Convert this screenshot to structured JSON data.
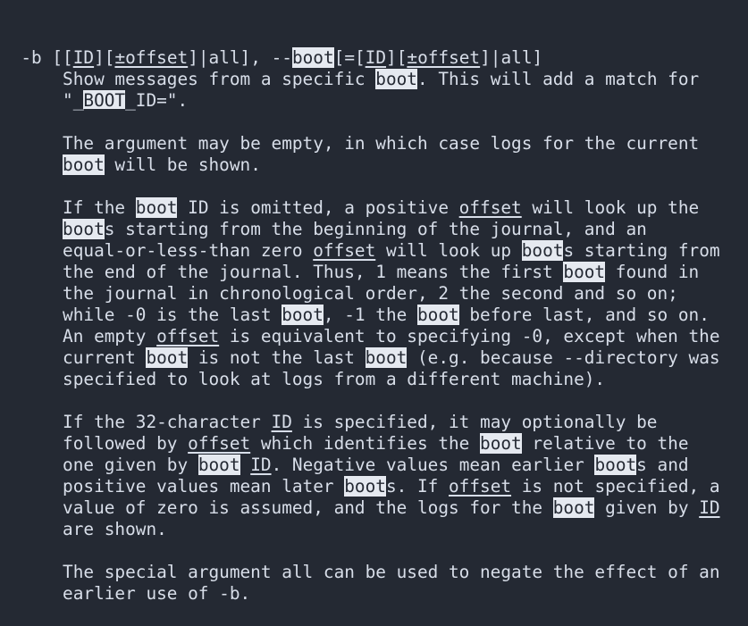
{
  "man_page": {
    "lines": [
      [
        [
          "  -b [[",
          ""
        ],
        [
          "ID",
          "ul"
        ],
        [
          "][",
          ""
        ],
        [
          "±offset",
          "ul"
        ],
        [
          "]|all], --",
          ""
        ],
        [
          "boot",
          "hl"
        ],
        [
          "[=[",
          ""
        ],
        [
          "ID",
          "ul"
        ],
        [
          "][",
          ""
        ],
        [
          "±offset",
          "ul"
        ],
        [
          "]|all]",
          ""
        ]
      ],
      [
        [
          "      Show messages from a specific ",
          ""
        ],
        [
          "boot",
          "hl"
        ],
        [
          ". This will add a match for",
          ""
        ]
      ],
      [
        [
          "      \"_",
          ""
        ],
        [
          "BOOT",
          "hl-ul"
        ],
        [
          "_ID=\".",
          ""
        ]
      ],
      [
        [
          "",
          ""
        ]
      ],
      [
        [
          "      The argument may be empty, in which case logs for the current",
          ""
        ]
      ],
      [
        [
          "      ",
          ""
        ],
        [
          "boot",
          "hl"
        ],
        [
          " will be shown.",
          ""
        ]
      ],
      [
        [
          "",
          ""
        ]
      ],
      [
        [
          "      If the ",
          ""
        ],
        [
          "boot",
          "hl"
        ],
        [
          " ID is omitted, a positive ",
          ""
        ],
        [
          "offset",
          "ul"
        ],
        [
          " will look up the",
          ""
        ]
      ],
      [
        [
          "      ",
          ""
        ],
        [
          "boot",
          "hl"
        ],
        [
          "s starting from the beginning of the journal, and an",
          ""
        ]
      ],
      [
        [
          "      equal-or-less-than zero ",
          ""
        ],
        [
          "offset",
          "ul"
        ],
        [
          " will look up ",
          ""
        ],
        [
          "boot",
          "hl"
        ],
        [
          "s starting from",
          ""
        ]
      ],
      [
        [
          "      the end of the journal. Thus, 1 means the first ",
          ""
        ],
        [
          "boot",
          "hl"
        ],
        [
          " found in",
          ""
        ]
      ],
      [
        [
          "      the journal in chronological order, 2 the second and so on;",
          ""
        ]
      ],
      [
        [
          "      while -0 is the last ",
          ""
        ],
        [
          "boot",
          "hl"
        ],
        [
          ", -1 the ",
          ""
        ],
        [
          "boot",
          "hl"
        ],
        [
          " before last, and so on.",
          ""
        ]
      ],
      [
        [
          "      An empty ",
          ""
        ],
        [
          "offset",
          "ul"
        ],
        [
          " is equivalent to specifying -0, except when the",
          ""
        ]
      ],
      [
        [
          "      current ",
          ""
        ],
        [
          "boot",
          "hl"
        ],
        [
          " is not the last ",
          ""
        ],
        [
          "boot",
          "hl"
        ],
        [
          " (e.g. because --directory was",
          ""
        ]
      ],
      [
        [
          "      specified to look at logs from a different machine).",
          ""
        ]
      ],
      [
        [
          "",
          ""
        ]
      ],
      [
        [
          "      If the 32-character ",
          ""
        ],
        [
          "ID",
          "ul"
        ],
        [
          " is specified, it may optionally be",
          ""
        ]
      ],
      [
        [
          "      followed by ",
          ""
        ],
        [
          "offset",
          "ul"
        ],
        [
          " which identifies the ",
          ""
        ],
        [
          "boot",
          "hl"
        ],
        [
          " relative to the",
          ""
        ]
      ],
      [
        [
          "      one given by ",
          ""
        ],
        [
          "boot",
          "hl"
        ],
        [
          " ",
          ""
        ],
        [
          "ID",
          "ul"
        ],
        [
          ". Negative values mean earlier ",
          ""
        ],
        [
          "boot",
          "hl"
        ],
        [
          "s and",
          ""
        ]
      ],
      [
        [
          "      positive values mean later ",
          ""
        ],
        [
          "boot",
          "hl"
        ],
        [
          "s. If ",
          ""
        ],
        [
          "offset",
          "ul"
        ],
        [
          " is not specified, a",
          ""
        ]
      ],
      [
        [
          "      value of zero is assumed, and the logs for the ",
          ""
        ],
        [
          "boot",
          "hl"
        ],
        [
          " given by ",
          ""
        ],
        [
          "ID",
          "ul"
        ]
      ],
      [
        [
          "      are shown.",
          ""
        ]
      ],
      [
        [
          "",
          ""
        ]
      ],
      [
        [
          "      The special argument all can be used to negate the effect of an",
          ""
        ]
      ],
      [
        [
          "      earlier use of -b.",
          ""
        ]
      ]
    ]
  }
}
